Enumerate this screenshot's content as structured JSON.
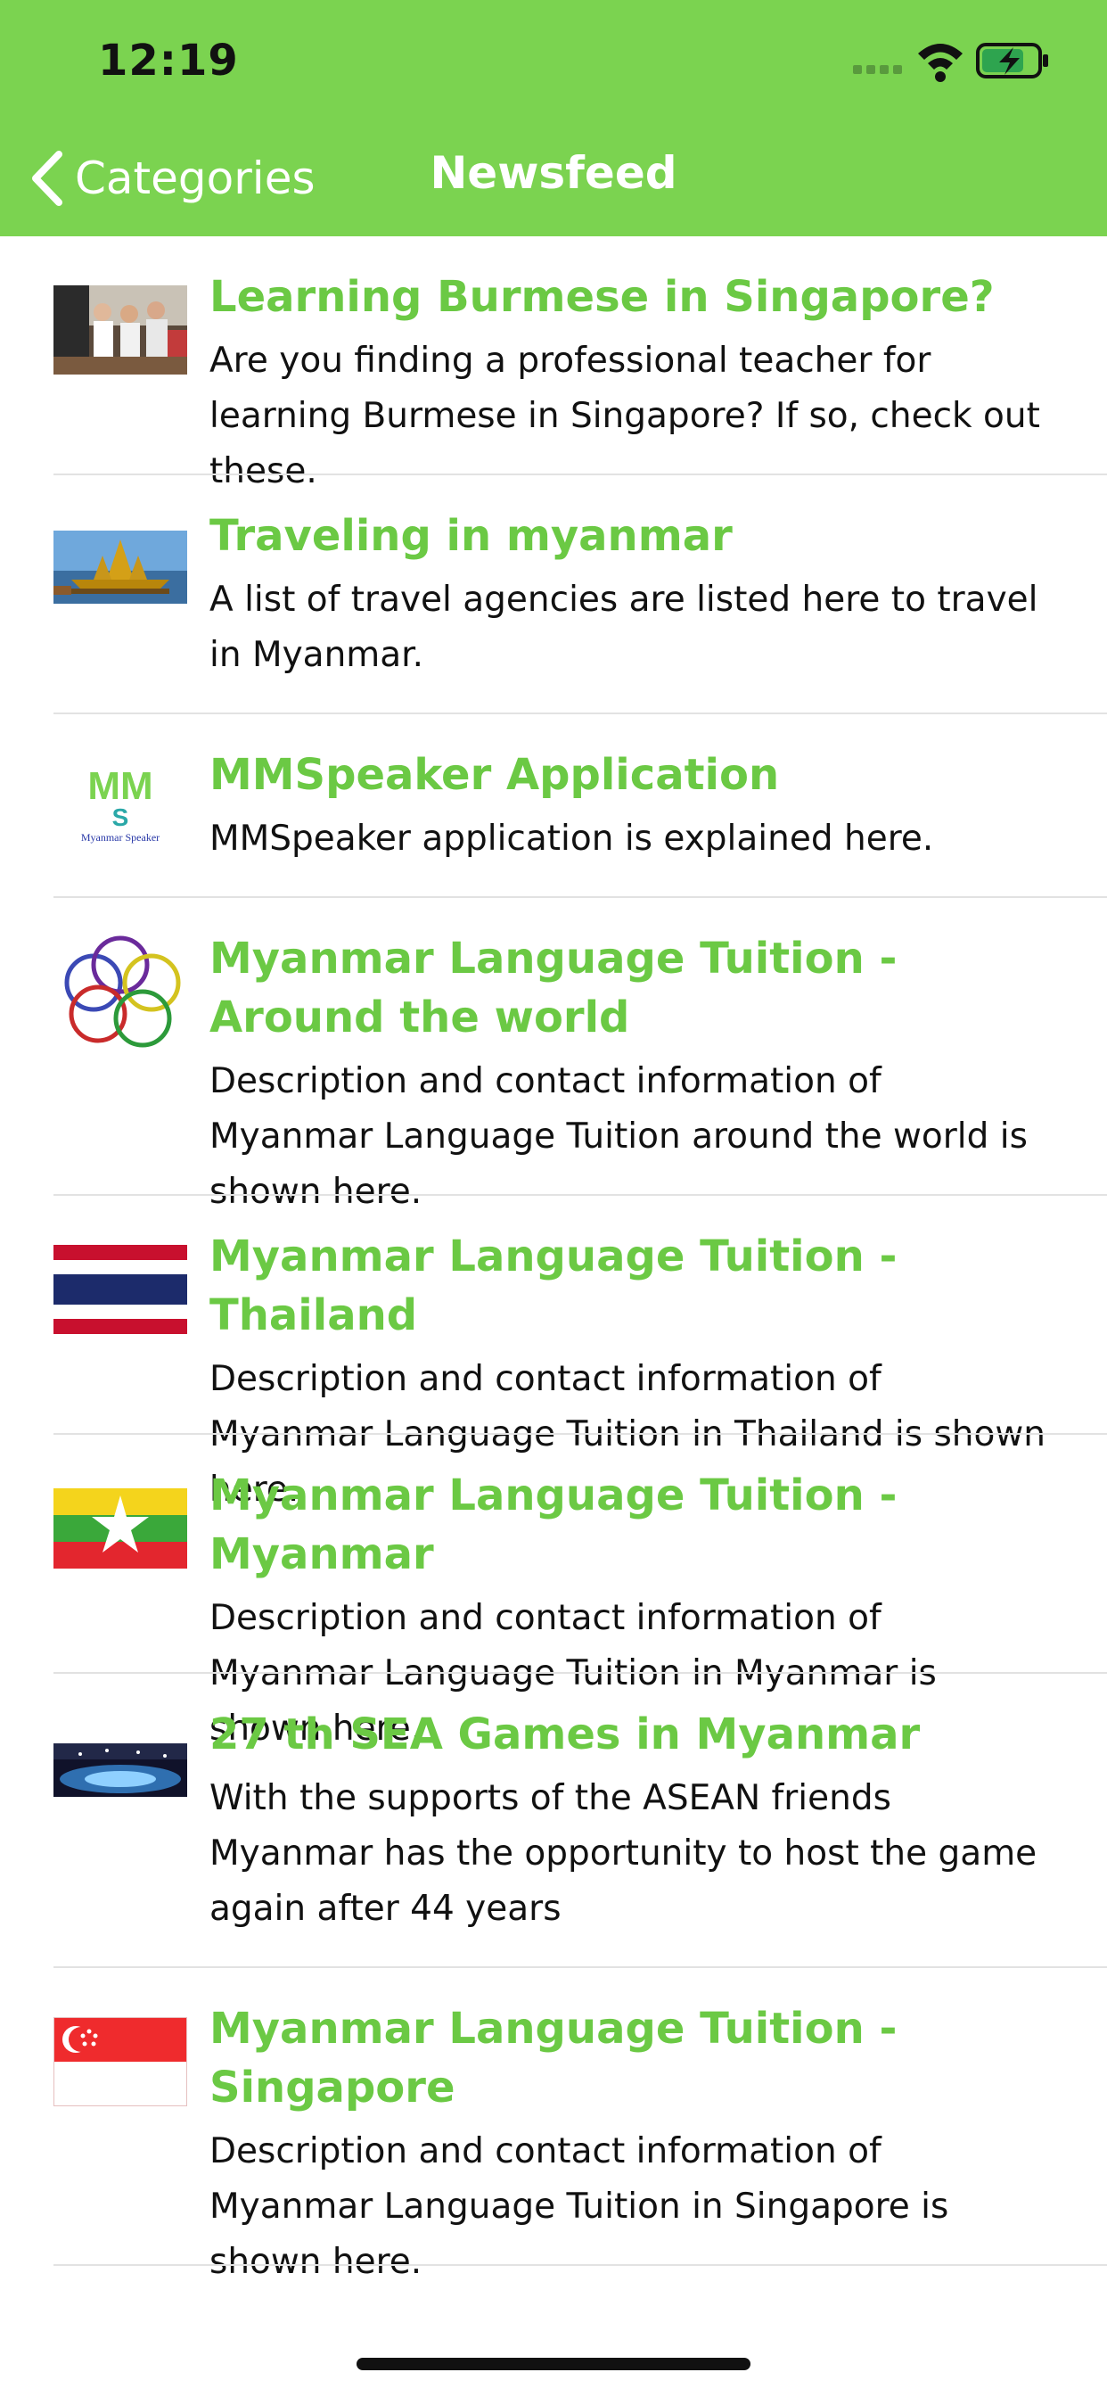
{
  "status_bar": {
    "time": "12:19"
  },
  "nav": {
    "back_label": "Categories",
    "title": "Newsfeed"
  },
  "colors": {
    "nav_background": "#7bd350",
    "title_green": "#6bc944",
    "text": "#111111",
    "divider": "#e2e2e2"
  },
  "feed": [
    {
      "title": "Learning Burmese in Singapore?",
      "description": "Are you finding a professional teacher for learning Burmese in Singapore? If so, check out these.",
      "thumbnail": "classroom-photo"
    },
    {
      "title": "Traveling in myanmar",
      "description": "A list of travel agencies are listed here to travel in Myanmar.",
      "thumbnail": "royal-barge-photo"
    },
    {
      "title": "MMSpeaker Application",
      "description": "MMSpeaker application is explained here.",
      "thumbnail": "mmspeaker-logo",
      "thumbnail_text": {
        "letters": "MM",
        "s": "S",
        "caption": "Myanmar Speaker"
      }
    },
    {
      "title": "Myanmar Language Tuition - Around the world",
      "description": "Description and contact information of Myanmar Language Tuition around the world is shown here.",
      "thumbnail": "rings-logo"
    },
    {
      "title": "Myanmar Language Tuition - Thailand",
      "description": "Description and contact information of Myanmar Language Tuition in Thailand is shown here.",
      "thumbnail": "thailand-flag"
    },
    {
      "title": "Myanmar Language Tuition - Myanmar",
      "description": "Description and contact information of Myanmar Language Tuition in Myanmar is shown here.",
      "thumbnail": "myanmar-flag"
    },
    {
      "title": "27 th SEA Games in Myanmar",
      "description": "With the supports of the ASEAN friends Myanmar has the opportunity to host the game again after 44 years",
      "thumbnail": "stadium-photo"
    },
    {
      "title": "Myanmar Language Tuition - Singapore",
      "description": "Description and contact information of Myanmar Language Tuition in Singapore is shown here.",
      "thumbnail": "singapore-flag"
    }
  ]
}
